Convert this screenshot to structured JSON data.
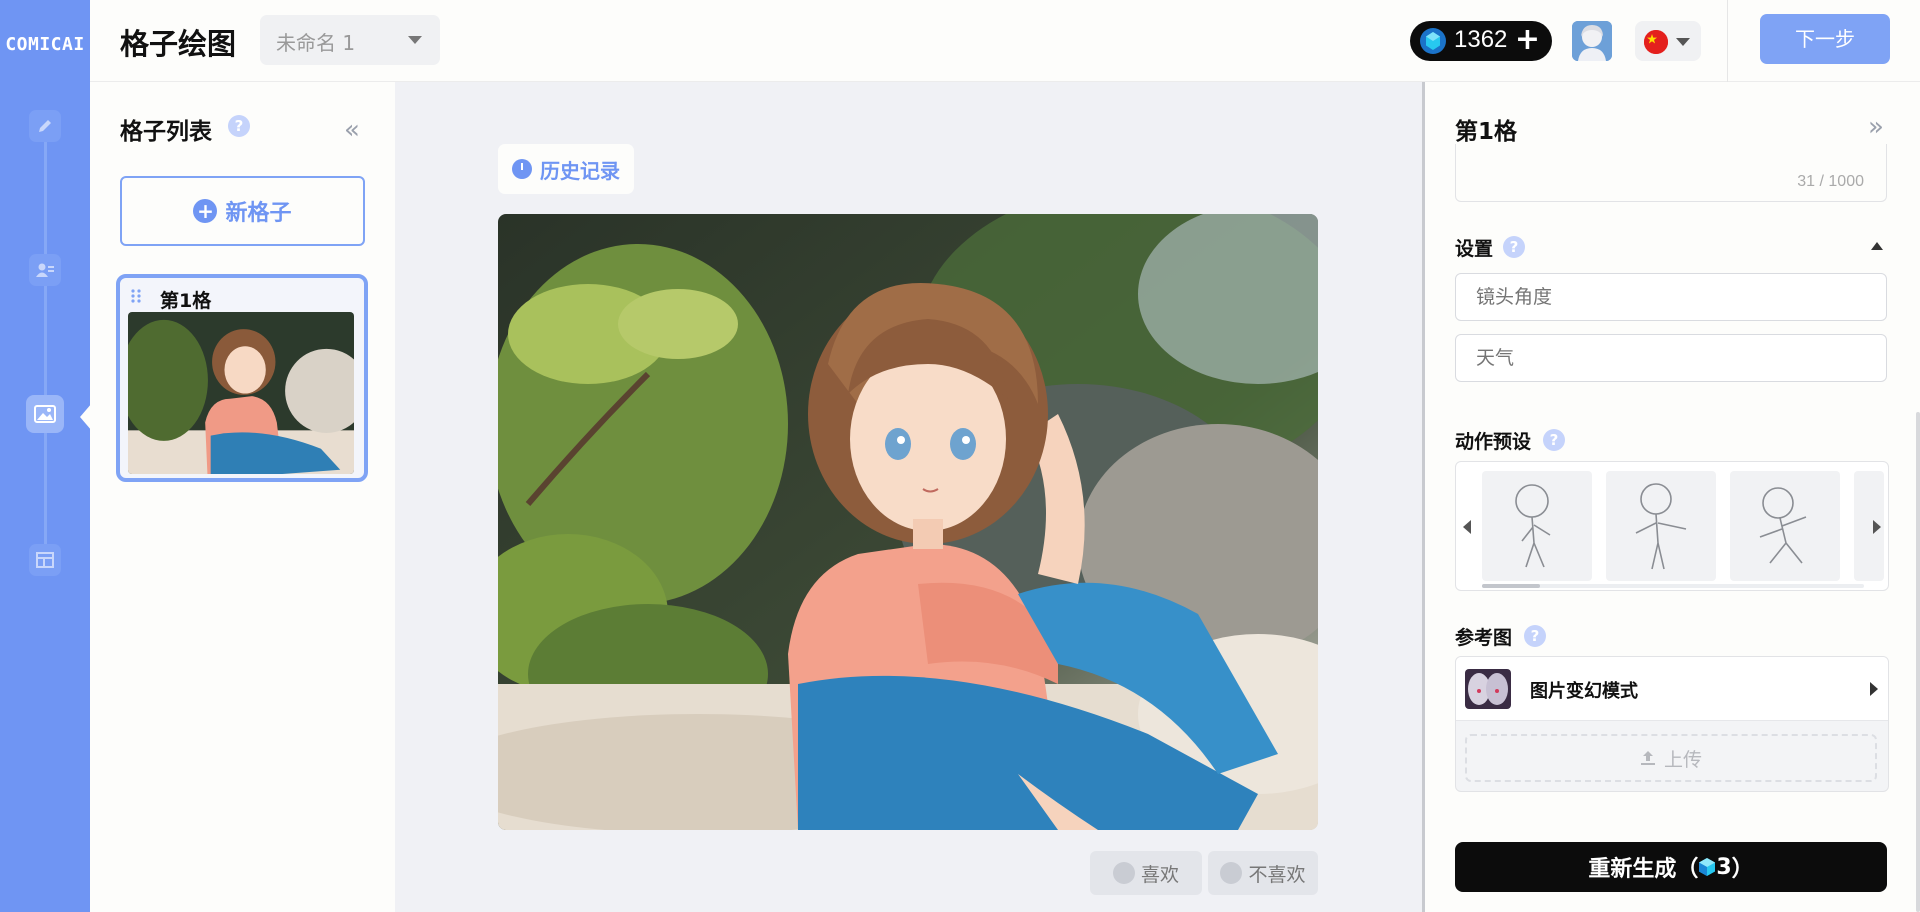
{
  "brand": {
    "logo": "COMICAI",
    "accent": "#6f95f3"
  },
  "rail": {
    "items": [
      "edit-icon",
      "character-icon",
      "image-icon",
      "layout-icon"
    ],
    "active": "image-icon"
  },
  "header": {
    "title": "格子绘图",
    "project_name": "未命名 1",
    "credits": "1362",
    "credits_plus": "+",
    "next_label": "下一步"
  },
  "panel_list": {
    "title": "格子列表",
    "help": "?",
    "collapse": "«",
    "new_panel_label": "新格子",
    "panels": [
      {
        "label": "第1格"
      }
    ]
  },
  "center": {
    "history_label": "历史记录",
    "like_label": "喜欢",
    "dislike_label": "不喜欢"
  },
  "detail": {
    "title": "第1格",
    "collapse": "»",
    "char_count": "31 / 1000",
    "settings_label": "设置",
    "camera_placeholder": "镜头角度",
    "weather_placeholder": "天气",
    "pose_label": "动作预设",
    "reference_label": "参考图",
    "reference_mode": "图片变幻模式",
    "upload_label": "上传",
    "regenerate_label": "重新生成（",
    "regenerate_cost": "3",
    "regenerate_suffix": "）"
  }
}
